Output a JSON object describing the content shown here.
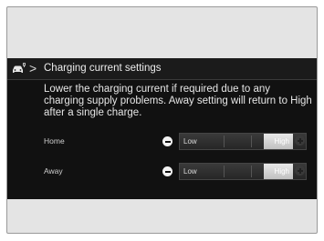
{
  "header": {
    "icon": "ev-car-icon",
    "separator": ">",
    "title": "Charging current settings"
  },
  "description": "Lower the charging current if required due to any charging supply problems. Away setting will return to High after a single charge.",
  "settings": [
    {
      "label": "Home",
      "min_label": "Low",
      "max_label": "High",
      "level": 1.0
    },
    {
      "label": "Away",
      "min_label": "Low",
      "max_label": "High",
      "level": 1.0
    }
  ],
  "colors": {
    "screen_bg": "#111111",
    "text": "#e6e6e6",
    "thumb": "#d0d0d0"
  }
}
